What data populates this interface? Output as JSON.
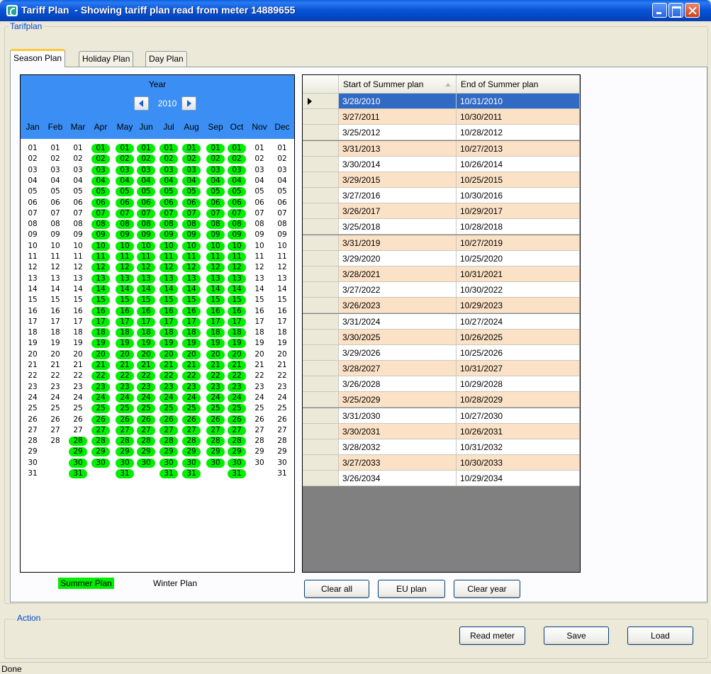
{
  "window": {
    "title": "Tariff Plan  - Showing tariff plan read from meter 14889655"
  },
  "group_tarifplan": "Tarifplan",
  "tabs": [
    "Season Plan",
    "Holiday Plan",
    "Day Plan"
  ],
  "calendar": {
    "year_label": "Year",
    "year": "2010",
    "months": [
      "Jan",
      "Feb",
      "Mar",
      "Apr",
      "May",
      "Jun",
      "Jul",
      "Aug",
      "Sep",
      "Oct",
      "Nov",
      "Dec"
    ],
    "month_days": [
      31,
      28,
      31,
      30,
      31,
      30,
      31,
      31,
      30,
      31,
      30,
      31
    ],
    "summer_start": {
      "month": 3,
      "day": 28
    },
    "summer_end": {
      "month": 10,
      "day": 31
    },
    "summer_color": "#00ee00"
  },
  "legend": {
    "summer": "Summer Plan",
    "winter": "Winter Plan"
  },
  "grid": {
    "columns": [
      "Start of Summer plan",
      "End of Summer plan"
    ],
    "selected_row": 0,
    "alt_color": "#fbe1c6",
    "select_color": "#316ac5",
    "rows": [
      [
        "3/28/2010",
        "10/31/2010"
      ],
      [
        "3/27/2011",
        "10/30/2011"
      ],
      [
        "3/25/2012",
        "10/28/2012"
      ],
      [
        "3/31/2013",
        "10/27/2013"
      ],
      [
        "3/30/2014",
        "10/26/2014"
      ],
      [
        "3/29/2015",
        "10/25/2015"
      ],
      [
        "3/27/2016",
        "10/30/2016"
      ],
      [
        "3/26/2017",
        "10/29/2017"
      ],
      [
        "3/25/2018",
        "10/28/2018"
      ],
      [
        "3/31/2019",
        "10/27/2019"
      ],
      [
        "3/29/2020",
        "10/25/2020"
      ],
      [
        "3/28/2021",
        "10/31/2021"
      ],
      [
        "3/27/2022",
        "10/30/2022"
      ],
      [
        "3/26/2023",
        "10/29/2023"
      ],
      [
        "3/31/2024",
        "10/27/2024"
      ],
      [
        "3/30/2025",
        "10/26/2025"
      ],
      [
        "3/29/2026",
        "10/25/2026"
      ],
      [
        "3/28/2027",
        "10/31/2027"
      ],
      [
        "3/26/2028",
        "10/29/2028"
      ],
      [
        "3/25/2029",
        "10/28/2029"
      ],
      [
        "3/31/2030",
        "10/27/2030"
      ],
      [
        "3/30/2031",
        "10/26/2031"
      ],
      [
        "3/28/2032",
        "10/31/2032"
      ],
      [
        "3/27/2033",
        "10/30/2033"
      ],
      [
        "3/26/2034",
        "10/29/2034"
      ]
    ]
  },
  "plan_buttons": {
    "clear_all": "Clear all",
    "eu_plan": "EU plan",
    "clear_year": "Clear year"
  },
  "group_action": "Action",
  "action_buttons": {
    "read_meter": "Read meter",
    "save": "Save",
    "load": "Load"
  },
  "status": "Done"
}
